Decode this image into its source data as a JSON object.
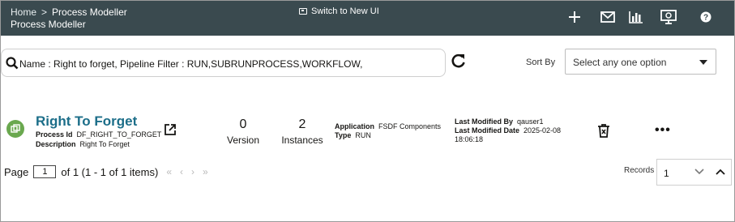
{
  "header": {
    "breadcrumb_home": "Home",
    "breadcrumb_sep": ">",
    "breadcrumb_current": "Process Modeller",
    "title": "Process Modeller",
    "switch_ui": "Switch to New UI",
    "icons": [
      "plus-icon",
      "mail-icon",
      "chart-icon",
      "monitor-icon",
      "help-icon"
    ],
    "bg_color": "#3a4a4f"
  },
  "search": {
    "query": "Name : Right to forget, Pipeline Filter : RUN,SUBRUNPROCESS,WORKFLOW,"
  },
  "sort": {
    "label": "Sort By",
    "placeholder": "Select any one option"
  },
  "record": {
    "name": "Right To Forget",
    "process_id_label": "Process Id",
    "process_id": "DF_RIGHT_TO_FORGET",
    "description_label": "Description",
    "description": "Right To Forget",
    "version_count": "0",
    "version_label": "Version",
    "instances_count": "2",
    "instances_label": "Instances",
    "application_label": "Application",
    "application": "FSDF Components",
    "type_label": "Type",
    "type": "RUN",
    "last_modified_by_label": "Last Modified By",
    "last_modified_by": "qauser1",
    "last_modified_date_label": "Last Modified Date",
    "last_modified_date": "2025-02-08",
    "last_modified_time": "18:06:18",
    "more": "•••",
    "name_color": "#1c6e89"
  },
  "pagination": {
    "page_label": "Page",
    "page_value": "1",
    "of_text": "of 1 (1 - 1 of 1 items)",
    "first": "«",
    "prev": "‹",
    "next": "›",
    "last": "»",
    "records_label": "Records",
    "records_value": "1"
  }
}
